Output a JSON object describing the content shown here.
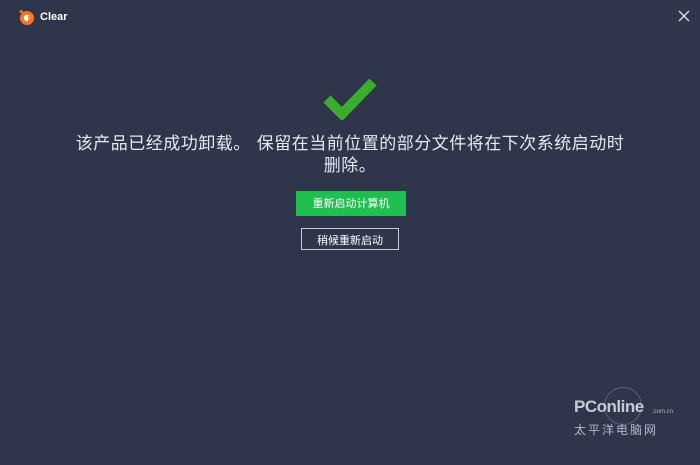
{
  "app": {
    "title": "Clear",
    "logo_icon": "avast-logo-icon",
    "brand_color": "#f7761f"
  },
  "main": {
    "status_icon": "checkmark-icon",
    "status_color": "#3aae2a",
    "message": "该产品已经成功卸载。 保留在当前位置的部分文件将在下次系统启动时删除。"
  },
  "actions": {
    "restart_now_label": "重新启动计算机",
    "restart_later_label": "稍候重新启动",
    "primary_color": "#1fbf4f"
  },
  "watermark": {
    "brand": "PConline",
    "domain": ".com.cn",
    "subtitle": "太平洋电脑网"
  },
  "colors": {
    "background": "#2f364b"
  }
}
